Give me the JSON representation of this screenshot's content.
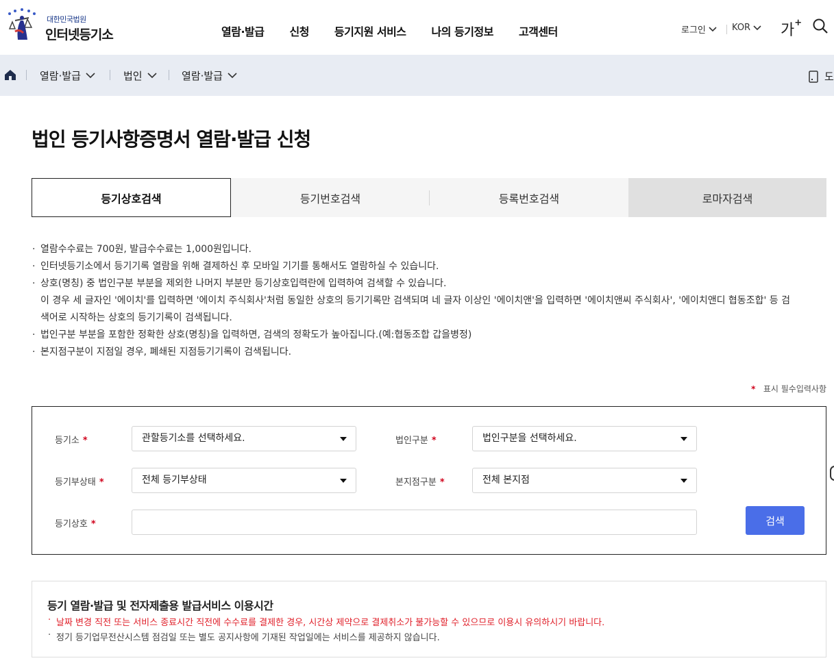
{
  "header": {
    "logo_sub": "대한민국법원",
    "logo_main": "인터넷등기소",
    "nav": [
      "열람·발급",
      "신청",
      "등기지원 서비스",
      "나의 등기정보",
      "고객센터"
    ],
    "login": "로그인",
    "language": "KOR",
    "font_size_label": "가",
    "font_size_plus": "+"
  },
  "breadcrumb": {
    "items": [
      "열람·발급",
      "법인",
      "열람·발급"
    ],
    "print_label": "도"
  },
  "page_title": "법인 등기사항증명서 열람·발급 신청",
  "tabs": [
    {
      "label": "등기상호검색",
      "active": true
    },
    {
      "label": "등기번호검색",
      "active": false
    },
    {
      "label": "등록번호검색",
      "active": false
    },
    {
      "label": "로마자검색",
      "active": false
    }
  ],
  "notices": [
    "열람수수료는 700원, 발급수수료는 1,000원입니다.",
    "인터넷등기소에서 등기기록 열람을 위해 결제하신 후 모바일 기기를 통해서도 열람하실 수 있습니다.",
    "상호(명칭) 중 법인구분 부분을 제외한 나머지 부분만 등기상호입력란에 입력하여 검색할 수 있습니다.",
    "법인구분 부분을 포함한 정확한 상호(명칭)을 입력하면, 검색의 정확도가 높아집니다.(예:협동조합 갑을병정)",
    "본지점구분이 지점일 경우, 폐쇄된 지점등기기록이 검색됩니다."
  ],
  "notice_continuation_1": "이 경우 세 글자인 '에이치'를 입력하면 '에이치 주식회사'처럼 동일한 상호의 등기기록만 검색되며 네 글자 이상인 '에이치앤'을 입력하면 '에이치앤씨 주식회사', '에이치앤디 협동조합' 등 검",
  "notice_continuation_2": "색어로 시작하는 상호의 등기기록이 검색됩니다.",
  "required_note": {
    "star": "*",
    "text": "표시 필수입력사항"
  },
  "form": {
    "registry_office_label": "등기소",
    "registry_office_value": "관할등기소를 선택하세요.",
    "corp_type_label": "법인구분",
    "corp_type_value": "법인구분을 선택하세요.",
    "registry_status_label": "등기부상태",
    "registry_status_value": "전체 등기부상태",
    "branch_type_label": "본지점구분",
    "branch_type_value": "전체 본지점",
    "trade_name_label": "등기상호",
    "trade_name_value": "",
    "search_button": "검색",
    "required_star": "*"
  },
  "service_info": {
    "title": "등기 열람·발급 및 전자제출용 발급서비스 이용시간",
    "warning": "날짜 변경 직전 또는 서비스 종료시간 직전에 수수료를 결제한 경우, 시간상 제약으로 결제취소가 불가능할 수 있으므로 이용시 유의하시기 바랍니다.",
    "note": "정기 등기업무전산시스템 점검일 또는 별도 공지사항에 기재된 작업일에는 서비스를 제공하지 않습니다."
  },
  "colors": {
    "accent": "#4a6ee8",
    "breadcrumb_bg": "#e8ecf3",
    "required_star": "#d0021b",
    "warning_text": "#e0202a"
  }
}
